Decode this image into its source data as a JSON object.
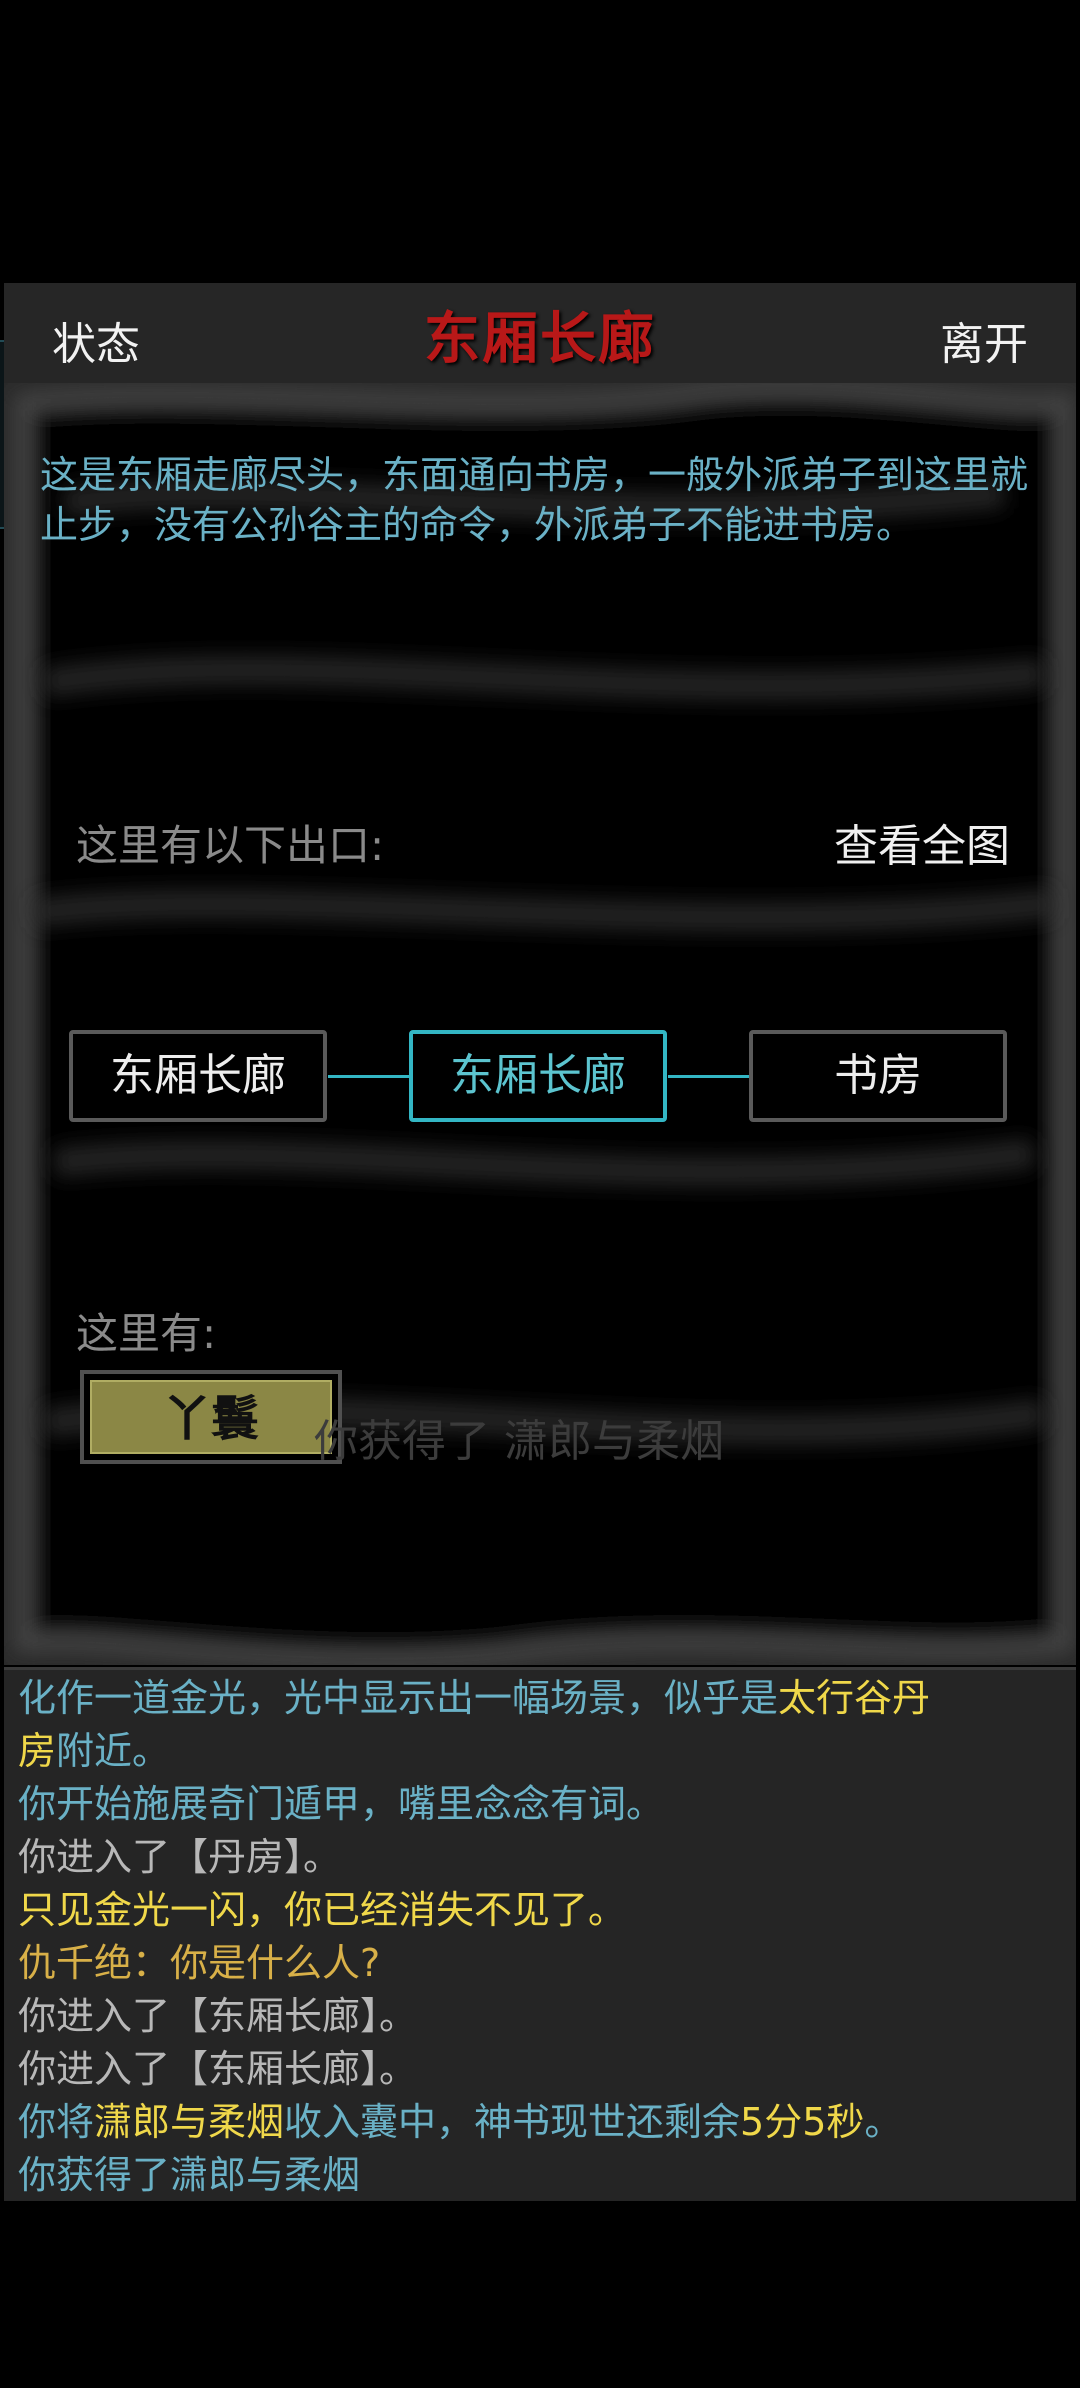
{
  "header": {
    "status_label": "状态",
    "title": "东厢长廊",
    "leave_label": "离开"
  },
  "description": "这是东厢走廊尽头，东面通向书房，一般外派弟子到这里就止步，没有公孙谷主的命令，外派弟子不能进书房。",
  "exits": {
    "label": "这里有以下出口:",
    "map_link": "查看全图",
    "rooms": [
      {
        "name": "东厢长廊",
        "current": false
      },
      {
        "name": "东厢长廊",
        "current": true
      },
      {
        "name": "书房",
        "current": false
      }
    ]
  },
  "here": {
    "label": "这里有:",
    "npc": "丫鬟"
  },
  "toast": "你获得了 潇郎与柔烟",
  "log": [
    {
      "parts": [
        {
          "t": "化作一道金光，光中显示出一幅场景，似乎是",
          "c": "cyan"
        },
        {
          "t": "太行谷丹",
          "c": "yellow"
        }
      ]
    },
    {
      "parts": [
        {
          "t": "房",
          "c": "yellow"
        },
        {
          "t": "附近。",
          "c": "cyan"
        }
      ]
    },
    {
      "parts": [
        {
          "t": "你开始施展奇门遁甲，嘴里念念有词。",
          "c": "cyan"
        }
      ]
    },
    {
      "parts": [
        {
          "t": "你进入了【丹房】。",
          "c": "gray"
        }
      ]
    },
    {
      "parts": [
        {
          "t": "只见金光一闪，你已经消失不见了。",
          "c": "yellow"
        }
      ]
    },
    {
      "parts": [
        {
          "t": "仇千绝：你是什么人?",
          "c": "gold"
        }
      ]
    },
    {
      "parts": [
        {
          "t": "你进入了【东厢长廊】。",
          "c": "gray"
        }
      ]
    },
    {
      "parts": [
        {
          "t": "你进入了【东厢长廊】。",
          "c": "gray"
        }
      ]
    },
    {
      "parts": [
        {
          "t": "你将",
          "c": "cyan"
        },
        {
          "t": "潇郎与柔烟",
          "c": "yellow"
        },
        {
          "t": "收入囊中，神书现世还剩余",
          "c": "cyan"
        },
        {
          "t": "5分5秒",
          "c": "yellow"
        },
        {
          "t": "。",
          "c": "cyan"
        }
      ]
    },
    {
      "parts": [
        {
          "t": "你获得了潇郎与柔烟",
          "c": "cyan"
        }
      ]
    }
  ]
}
